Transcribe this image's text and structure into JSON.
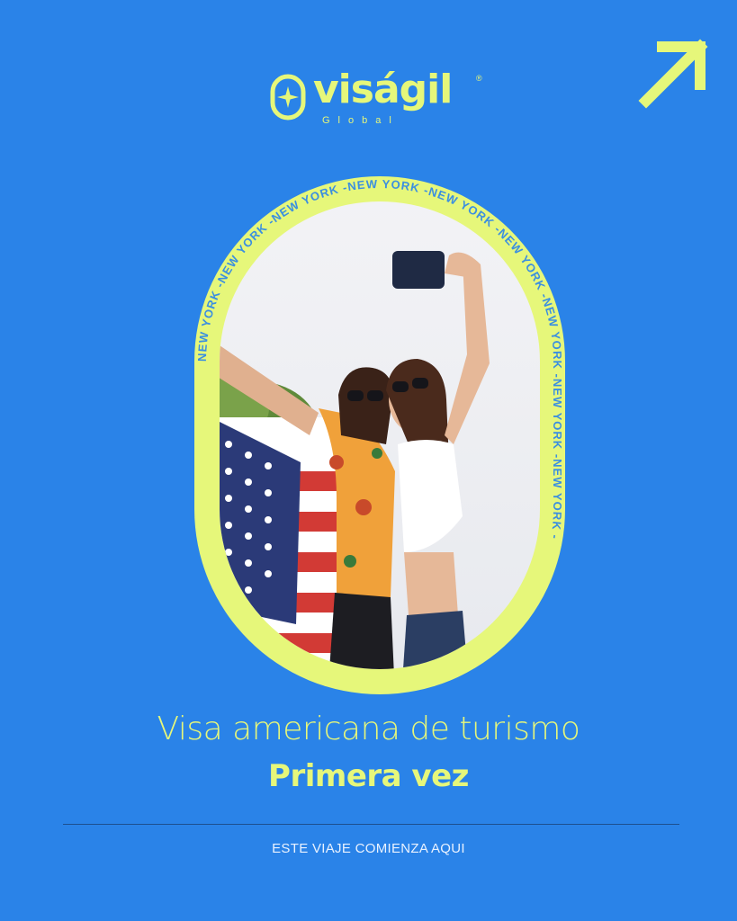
{
  "brand": {
    "name": "viságil",
    "registered": "®",
    "subtitle": "Global",
    "icon": "sparkle-pill-icon"
  },
  "corner": {
    "icon": "arrow-up-right-icon"
  },
  "photo": {
    "ring_text": "NEW YORK -NEW YORK -NEW YORK -NEW YORK -NEW YORK -NEW YORK -NEW YORK -NEW YORK -NEW YORK -"
  },
  "headline": {
    "title": "Visa americana de turismo",
    "subtitle": "Primera vez"
  },
  "footer": {
    "tagline": "ESTE VIAJE COMIENZA AQUI"
  },
  "colors": {
    "background": "#2a83e8",
    "accent": "#e6f77a",
    "divider": "#1d4f8f"
  }
}
